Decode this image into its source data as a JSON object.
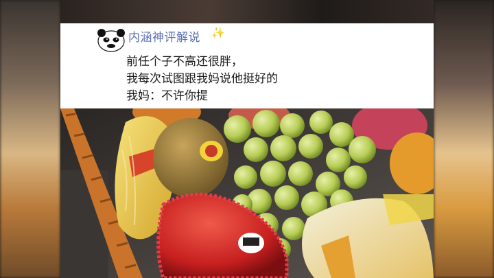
{
  "post": {
    "username": "内涵神评解说",
    "sparkle": "✨",
    "lines": [
      "前任个子不高还很胖，",
      "我每次试图跟我妈说他挺好的",
      "我妈：不许你提"
    ]
  },
  "photo": {
    "description_icon": "fruit-basket-photo",
    "sticker_codes": [
      "4311"
    ]
  }
}
